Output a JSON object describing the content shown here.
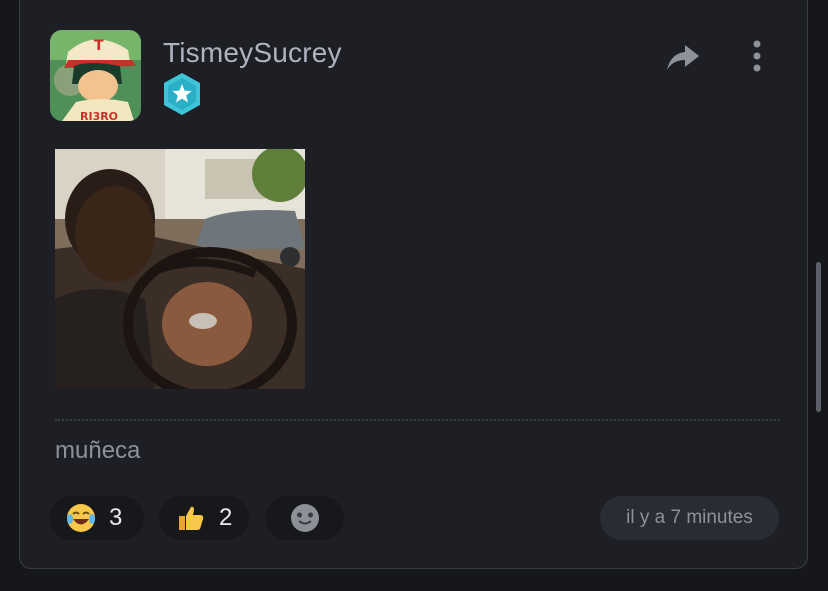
{
  "post": {
    "username": "TismeySucrey",
    "caption": "muñeca",
    "timestamp": "il y a 7 minutes",
    "reactions": [
      {
        "icon": "laughing-tears-emoji",
        "count": "3"
      },
      {
        "icon": "thumbs-up-emoji",
        "count": "2"
      },
      {
        "icon": "add-reaction-emoji",
        "count": ""
      }
    ]
  },
  "colors": {
    "background": "#16171b",
    "card": "#1e1f25",
    "badge": "#3ec6d8",
    "text_primary": "#aeb3c0",
    "text_muted": "#8d919b"
  }
}
